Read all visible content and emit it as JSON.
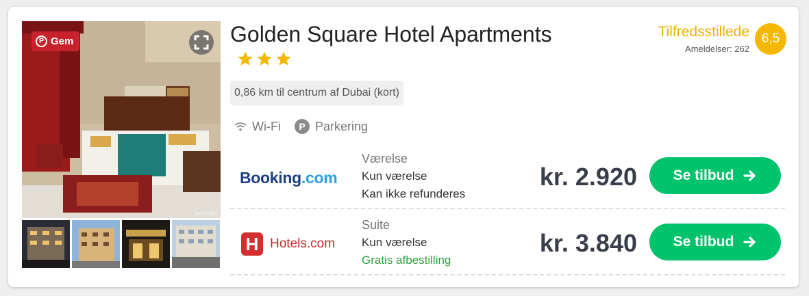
{
  "hotel": {
    "name": "Golden Square Hotel Apartments",
    "stars": 3,
    "rating_label": "Tilfredsstillede",
    "reviews_text": "Ameldelser: 262",
    "score": "6,5",
    "distance": "0,86 km til centrum af Dubai (kort)"
  },
  "photo": {
    "save_label": "Gem",
    "pinterest_glyph": "P",
    "expand_icon": "expand-icon",
    "thumbnails": [
      "exterior-night",
      "exterior-day",
      "entrance-night",
      "street-view"
    ],
    "watermark": "provider"
  },
  "amenities": [
    {
      "icon": "wifi-icon",
      "label": "Wi-Fi"
    },
    {
      "icon": "parking-icon",
      "glyph": "P",
      "label": "Parkering"
    }
  ],
  "offers": [
    {
      "provider": "Booking.com",
      "provider_main": "Booking",
      "provider_dot": ".com",
      "room_type": "Værelse",
      "line1": "Kun værelse",
      "line2": "Kan ikke refunderes",
      "price": "kr. 2.920",
      "button": "Se tilbud"
    },
    {
      "provider": "Hotels.com",
      "provider_glyph": "H",
      "room_type": "Suite",
      "line1": "Kun værelse",
      "line2": "Gratis afbestilling",
      "price": "kr. 3.840",
      "button": "Se tilbud"
    }
  ],
  "colors": {
    "accent_green": "#00c36b",
    "rating_yellow": "#f5b800",
    "pinterest_red": "#c8232c",
    "booking_blue": "#1e3f84",
    "hotels_red": "#d32f2f",
    "free_cancel_green": "#2e9e3e"
  }
}
